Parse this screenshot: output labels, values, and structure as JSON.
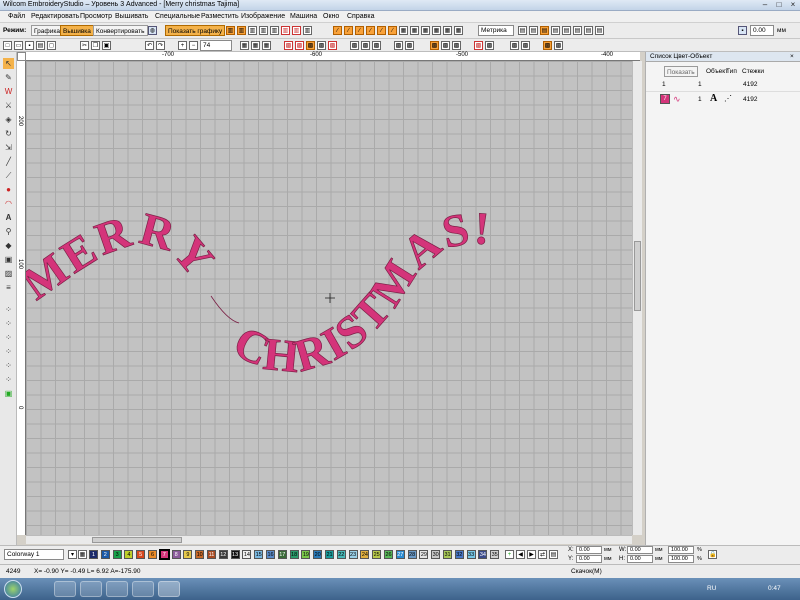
{
  "window": {
    "title": "Wilcom EmbroideryStudio – Уровень 3 Advanced - [Merry christmas      Tajima]"
  },
  "menu": [
    "Файл",
    "Редактировать",
    "Просмотр",
    "Вышивать",
    "Специальные",
    "Разместить",
    "Изображение",
    "Машина",
    "Окно",
    "Справка"
  ],
  "toolbar": {
    "mode_label": "Режим:",
    "graphics_button": "Графика",
    "embroidery_button": "Вышивка",
    "convert_button": "Конвертировать",
    "show_graphics_button": "Показать графику",
    "units_select": "Метрика",
    "size_value": "0.00",
    "size_unit": "мм",
    "zoom_value": "74"
  },
  "ruler": {
    "top": [
      "-700",
      "-600",
      "-500",
      "-400"
    ],
    "left": [
      "200",
      "100",
      "0"
    ]
  },
  "canvas": {
    "design_text_line1": "MERRY",
    "design_text_line2": "CHRISTMAS!",
    "thread_color": "#d4347a"
  },
  "panel": {
    "title": "Список Цвет-Объект",
    "show_button": "Показать",
    "col_object": "Объект",
    "col_type": "Тип",
    "col_stitches": "Стежки",
    "rows": [
      {
        "c1": "1",
        "c2": "1",
        "stitches": "4192"
      },
      {
        "c1": "7",
        "c2": "1",
        "stitches": "4192"
      }
    ]
  },
  "colorbar": {
    "colorway": "Colorway 1",
    "swatches": [
      "1",
      "2",
      "3",
      "4",
      "5",
      "6",
      "7",
      "8",
      "9",
      "10",
      "11",
      "12",
      "13",
      "14",
      "15",
      "16",
      "17",
      "18",
      "19",
      "20",
      "21",
      "22",
      "23",
      "24",
      "25",
      "26",
      "27",
      "28",
      "29",
      "30",
      "31",
      "32",
      "33",
      "34",
      "35"
    ],
    "fields": {
      "x_label": "X:",
      "x_value": "0.00",
      "x_unit": "мм",
      "y_label": "Y:",
      "y_value": "0.00",
      "y_unit": "мм",
      "w_label": "W:",
      "w_value": "0.00",
      "w_unit": "мм",
      "h_label": "H:",
      "h_value": "0.00",
      "h_unit": "мм",
      "sx_value": "100.00",
      "sx_unit": "%",
      "sy_value": "100.00",
      "sy_unit": "%"
    }
  },
  "status": {
    "stitch_count": "4249",
    "coords": "X= -0.90 Y= -0.49 L= 6.92 A=-175.90",
    "right_text": "Скачок(M)"
  },
  "taskbar": {
    "lang": "RU",
    "time": "0:47"
  }
}
